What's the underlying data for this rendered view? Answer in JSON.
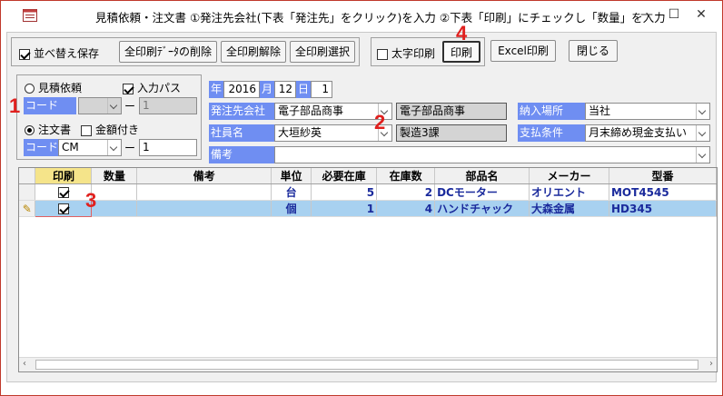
{
  "window": {
    "title": "見積依頼・注文書 ①発注先会社(下表「発注先」をクリック)を入力 ②下表「印刷」にチェックし「数量」を入力",
    "minimize": "—",
    "maximize": "☐",
    "close": "✕"
  },
  "toolbar": {
    "sort_save_label": "並べ替え保存",
    "sort_save_checked": true,
    "delete_print_data": "全印刷ﾃﾞｰﾀの削除",
    "clear_all_print": "全印刷解除",
    "select_all_print": "全印刷選択",
    "bold_print_label": "太字印刷",
    "bold_print_checked": false,
    "print_button": "印刷",
    "excel_print": "Excel印刷",
    "close_button": "閉じる"
  },
  "left_panel": {
    "estimate_label": "見積依頼",
    "input_pass_label": "入力パス",
    "input_pass_checked": true,
    "code_label_1": "コード",
    "code_value_1": "",
    "dash_1": "ー",
    "code_num_1": "1",
    "order_label": "注文書",
    "amount_label": "金額付き",
    "amount_checked": false,
    "code_label_2": "コード",
    "code_value_2": "CM",
    "dash_2": "ー",
    "code_num_2": "1"
  },
  "form": {
    "year_label": "年",
    "year": "2016",
    "month_label": "月",
    "month": "12",
    "day_label": "日",
    "day": "1",
    "supplier_label": "発注先会社",
    "supplier_value": "電子部品商事",
    "supplier_display": "電子部品商事",
    "employee_label": "社員名",
    "employee_value": "大垣紗英",
    "department_display": "製造3課",
    "delivery_label": "納入場所",
    "delivery_value": "当社",
    "payment_label": "支払条件",
    "payment_value": "月末締め現金支払い",
    "remarks_label": "備考",
    "remarks_value": ""
  },
  "grid": {
    "columns": [
      "印刷",
      "数量",
      "備考",
      "単位",
      "必要在庫",
      "在庫数",
      "部品名",
      "メーカー",
      "型番"
    ],
    "rows": [
      {
        "print": true,
        "qty": "",
        "remarks": "",
        "unit": "台",
        "required": "5",
        "stock": "2",
        "part": "DCモーター",
        "maker": "オリエント",
        "model": "MOT4545"
      },
      {
        "print": true,
        "qty": "",
        "remarks": "",
        "unit": "個",
        "required": "1",
        "stock": "4",
        "part": "ハンドチャック",
        "maker": "大森金属",
        "model": "HD345"
      }
    ],
    "row_pencil_icon": "pencil-icon"
  },
  "annotations": {
    "n1": "1",
    "n2": "2",
    "n3": "3",
    "n4": "4"
  },
  "colors": {
    "label_blue": "#6f8ef2",
    "selected_row": "#a8d1f0",
    "annotation_red": "#e0201e",
    "grid_text": "#1a2a9c"
  }
}
